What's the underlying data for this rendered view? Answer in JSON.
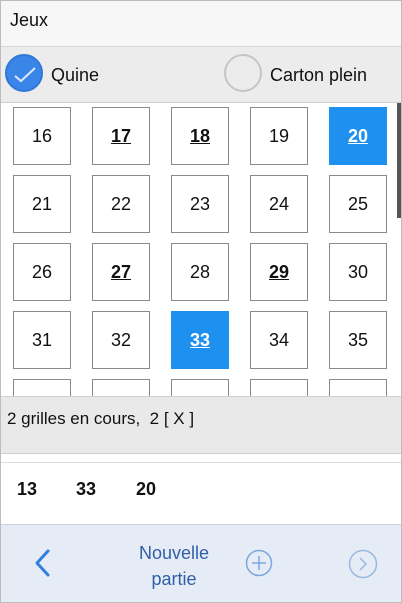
{
  "app": {
    "title": "Jeux"
  },
  "modes": {
    "quine": {
      "label": "Quine",
      "checked": true
    },
    "carton": {
      "label": "Carton plein",
      "checked": false
    }
  },
  "grid": {
    "cells": [
      {
        "n": "16",
        "state": "normal"
      },
      {
        "n": "17",
        "state": "bold"
      },
      {
        "n": "18",
        "state": "bold"
      },
      {
        "n": "19",
        "state": "normal"
      },
      {
        "n": "20",
        "state": "selected"
      },
      {
        "n": "21",
        "state": "normal"
      },
      {
        "n": "22",
        "state": "normal"
      },
      {
        "n": "23",
        "state": "normal"
      },
      {
        "n": "24",
        "state": "normal"
      },
      {
        "n": "25",
        "state": "normal"
      },
      {
        "n": "26",
        "state": "normal"
      },
      {
        "n": "27",
        "state": "bold"
      },
      {
        "n": "28",
        "state": "normal"
      },
      {
        "n": "29",
        "state": "bold"
      },
      {
        "n": "30",
        "state": "normal"
      },
      {
        "n": "31",
        "state": "normal"
      },
      {
        "n": "32",
        "state": "normal"
      },
      {
        "n": "33",
        "state": "selected"
      },
      {
        "n": "34",
        "state": "normal"
      },
      {
        "n": "35",
        "state": "normal"
      },
      {
        "n": "",
        "state": "normal"
      },
      {
        "n": "",
        "state": "normal"
      },
      {
        "n": "",
        "state": "normal"
      },
      {
        "n": "",
        "state": "normal"
      },
      {
        "n": "",
        "state": "normal"
      }
    ]
  },
  "status": {
    "text": "2 grilles en cours,  2 [ X ]"
  },
  "drawn_numbers": [
    "13",
    "33",
    "20"
  ],
  "bottom": {
    "new_game_line1": "Nouvelle",
    "new_game_line2": "partie"
  },
  "colors": {
    "accent": "#1e90f0",
    "radio_checked": "#3a86e8",
    "link": "#2f5fa8",
    "bottom_bg": "#e6ecf5"
  }
}
